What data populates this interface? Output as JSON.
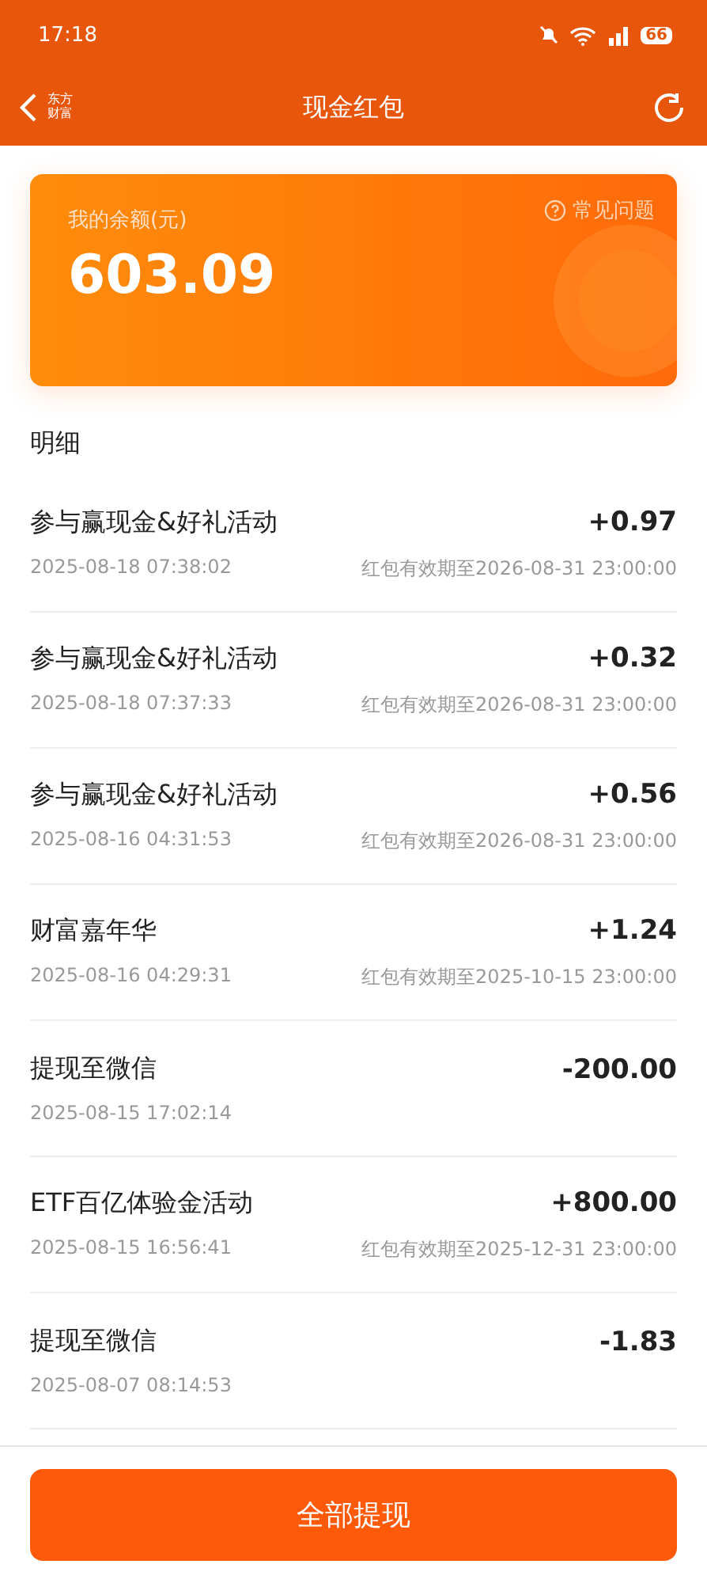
{
  "status_bar": {
    "time": "17:18",
    "battery": "66"
  },
  "nav": {
    "title": "现金红包",
    "brand": "东方财富"
  },
  "balance": {
    "label": "我的余额(元)",
    "amount": "603.09",
    "help": "常见问题"
  },
  "section_title": "明细",
  "records": [
    {
      "title": "参与赢现金&好礼活动",
      "amount": "+0.97",
      "time": "2025-08-18 07:38:02",
      "expiry": "红包有效期至2026-08-31 23:00:00"
    },
    {
      "title": "参与赢现金&好礼活动",
      "amount": "+0.32",
      "time": "2025-08-18 07:37:33",
      "expiry": "红包有效期至2026-08-31 23:00:00"
    },
    {
      "title": "参与赢现金&好礼活动",
      "amount": "+0.56",
      "time": "2025-08-16 04:31:53",
      "expiry": "红包有效期至2026-08-31 23:00:00"
    },
    {
      "title": "财富嘉年华",
      "amount": "+1.24",
      "time": "2025-08-16 04:29:31",
      "expiry": "红包有效期至2025-10-15 23:00:00"
    },
    {
      "title": "提现至微信",
      "amount": "-200.00",
      "time": "2025-08-15 17:02:14"
    },
    {
      "title": "ETF百亿体验金活动",
      "amount": "+800.00",
      "time": "2025-08-15 16:56:41",
      "expiry": "红包有效期至2025-12-31 23:00:00"
    },
    {
      "title": "提现至微信",
      "amount": "-1.83",
      "time": "2025-08-07 08:14:53"
    }
  ],
  "withdraw_button": "全部提现"
}
